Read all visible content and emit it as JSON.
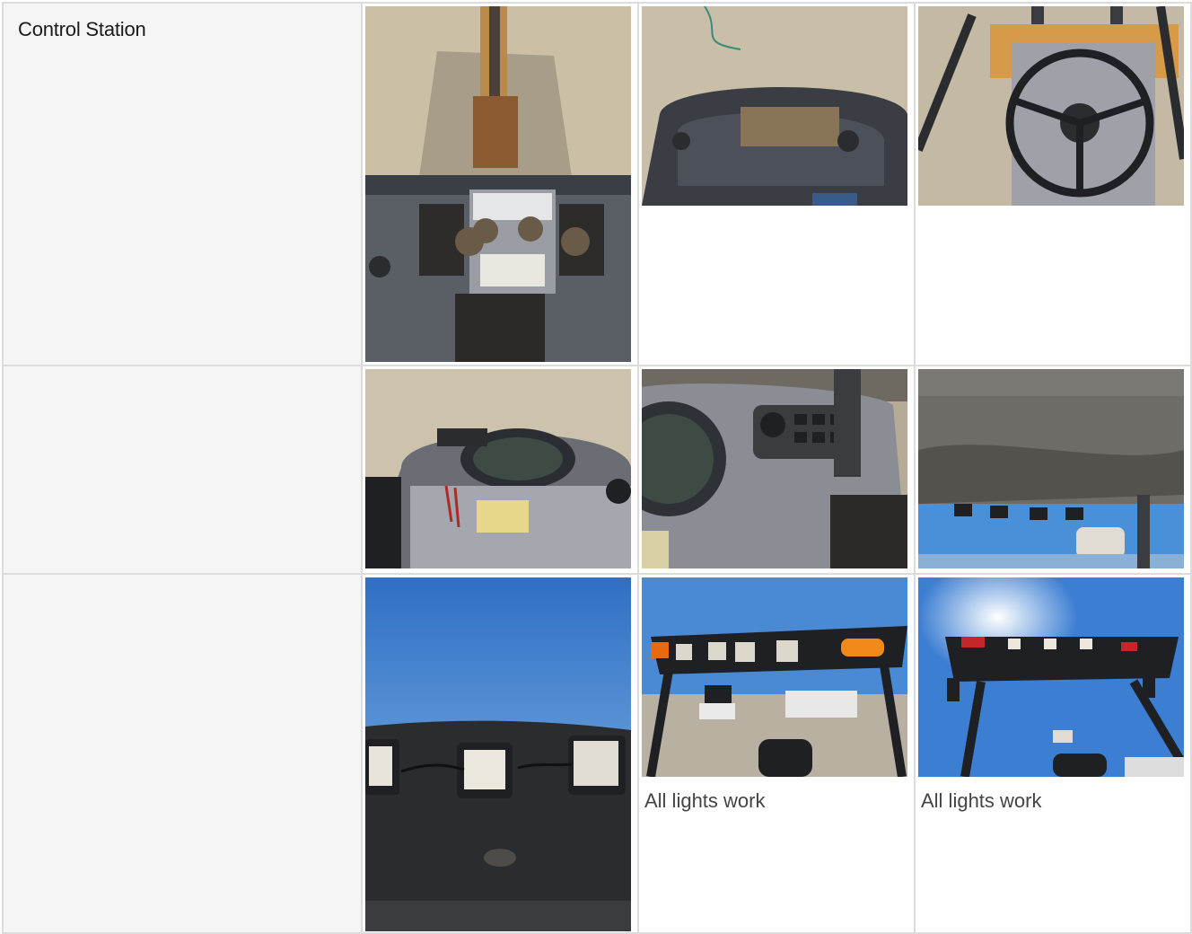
{
  "section": {
    "title": "Control Station"
  },
  "rows": [
    {
      "photos": [
        {
          "subject": "loader-controls-joysticks-photo",
          "caption": ""
        },
        {
          "subject": "dashboard-ignition-photo",
          "caption": ""
        },
        {
          "subject": "steering-wheel-photo",
          "caption": ""
        }
      ]
    },
    {
      "photos": [
        {
          "subject": "instrument-cluster-photo",
          "caption": ""
        },
        {
          "subject": "switch-panel-photo",
          "caption": ""
        },
        {
          "subject": "canopy-underside-photo",
          "caption": ""
        }
      ]
    },
    {
      "photos": [
        {
          "subject": "canopy-work-lights-photo",
          "caption": ""
        },
        {
          "subject": "canopy-front-lights-photo",
          "caption": "All lights work"
        },
        {
          "subject": "canopy-rear-lights-photo",
          "caption": "All lights work"
        }
      ]
    }
  ],
  "colors": {
    "border": "#dcdcdc",
    "label_background": "#f5f5f5",
    "caption_text": "#444444",
    "title_text": "#1a1a1a"
  }
}
